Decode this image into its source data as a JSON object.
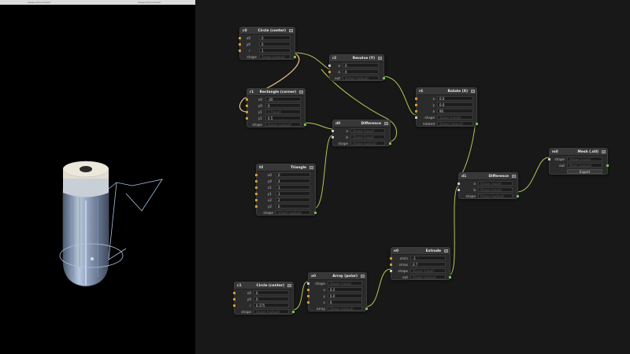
{
  "viewport": {
    "tabs": [
      "Viewport/ComPosit*",
      "Viewport/ComPosit*"
    ]
  },
  "nodes": {
    "c0": {
      "id": "c0",
      "title": "Circle (center)",
      "rows": [
        {
          "label": "x0",
          "value": "0"
        },
        {
          "label": "y0",
          "value": "0"
        },
        {
          "label": "r",
          "value": "1"
        },
        {
          "label": "shape",
          "value": "Shape (output)",
          "placeholder": true
        }
      ]
    },
    "r2": {
      "id": "r2",
      "title": "Revolve (Y)",
      "rows": [
        {
          "label": "x",
          "value": "0"
        },
        {
          "label": "a",
          "value": "0"
        },
        {
          "label": "out",
          "value": "Shape (output)",
          "placeholder": true
        }
      ]
    },
    "r1": {
      "id": "r1",
      "title": "Rectangle (corner)",
      "rows": [
        {
          "label": "x0",
          "value": "-20"
        },
        {
          "label": "y0",
          "value": "0"
        },
        {
          "label": "y1",
          "value": "1 (input)",
          "placeholder": true
        },
        {
          "label": "y1",
          "value": "4.5"
        },
        {
          "label": "shape",
          "value": "Shape (output)",
          "placeholder": true
        }
      ]
    },
    "r6": {
      "id": "r6",
      "title": "Rotate (X)",
      "rows": [
        {
          "label": "x",
          "value": "0.0"
        },
        {
          "label": "y",
          "value": "0.0"
        },
        {
          "label": "a",
          "value": "90"
        },
        {
          "label": "shape",
          "value": "Shape (input)",
          "placeholder": true
        },
        {
          "label": "rotated",
          "value": "Shape (output)",
          "placeholder": true
        }
      ]
    },
    "d0": {
      "id": "d0",
      "title": "Difference",
      "rows": [
        {
          "label": "a",
          "value": "Shape (input)",
          "placeholder": true
        },
        {
          "label": "b",
          "value": "Shape (input)",
          "placeholder": true
        },
        {
          "label": "shape",
          "value": "Shape (output)",
          "placeholder": true
        }
      ]
    },
    "t0": {
      "id": "t0",
      "title": "Triangle",
      "rows": [
        {
          "label": "x0",
          "value": "0"
        },
        {
          "label": "y0",
          "value": "4"
        },
        {
          "label": "x1",
          "value": "3"
        },
        {
          "label": "y1",
          "value": "3"
        },
        {
          "label": "x2",
          "value": "2"
        },
        {
          "label": "y2",
          "value": "6"
        },
        {
          "label": "shape",
          "value": "Shape (output)",
          "placeholder": true
        }
      ]
    },
    "m0": {
      "id": "m0",
      "title": "Mesh (.stl)",
      "rows": [
        {
          "label": "shape",
          "value": "Shape (input)",
          "placeholder": true
        },
        {
          "label": "out",
          "value": "Mesh (output)",
          "placeholder": true
        }
      ],
      "export_label": "Export"
    },
    "d1": {
      "id": "d1",
      "title": "Difference",
      "rows": [
        {
          "label": "a",
          "value": "Shape (input)",
          "placeholder": true
        },
        {
          "label": "b",
          "value": "Shape (input)",
          "placeholder": true
        },
        {
          "label": "shape",
          "value": "Shape (output)",
          "placeholder": true
        }
      ]
    },
    "e0": {
      "id": "e0",
      "title": "Extrude",
      "rows": [
        {
          "label": "zmin",
          "value": "-1"
        },
        {
          "label": "zmax",
          "value": "0.7"
        },
        {
          "label": "shape",
          "value": "Shape (input)",
          "placeholder": true
        },
        {
          "label": "out",
          "value": "Shape (output)",
          "placeholder": true
        }
      ]
    },
    "a0": {
      "id": "a0",
      "title": "Array (polar)",
      "rows": [
        {
          "label": "shape",
          "value": "Shape (input)",
          "placeholder": true
        },
        {
          "label": "x",
          "value": "0.2"
        },
        {
          "label": "y",
          "value": "0.0"
        },
        {
          "label": "n",
          "value": "6"
        },
        {
          "label": "array",
          "value": "Shape (output)",
          "placeholder": true
        }
      ]
    },
    "c1": {
      "id": "c1",
      "title": "Circle (center)",
      "rows": [
        {
          "label": "x0",
          "value": "0"
        },
        {
          "label": "y0",
          "value": "0"
        },
        {
          "label": "r",
          "value": "0.375"
        },
        {
          "label": "shape",
          "value": "Shape (output)",
          "placeholder": true
        }
      ]
    }
  },
  "colors": {
    "wire_active": "#b4c85a",
    "wire_selected": "#e6c08a",
    "port_in": "#d39a2c",
    "port_out": "#6fc24b"
  }
}
